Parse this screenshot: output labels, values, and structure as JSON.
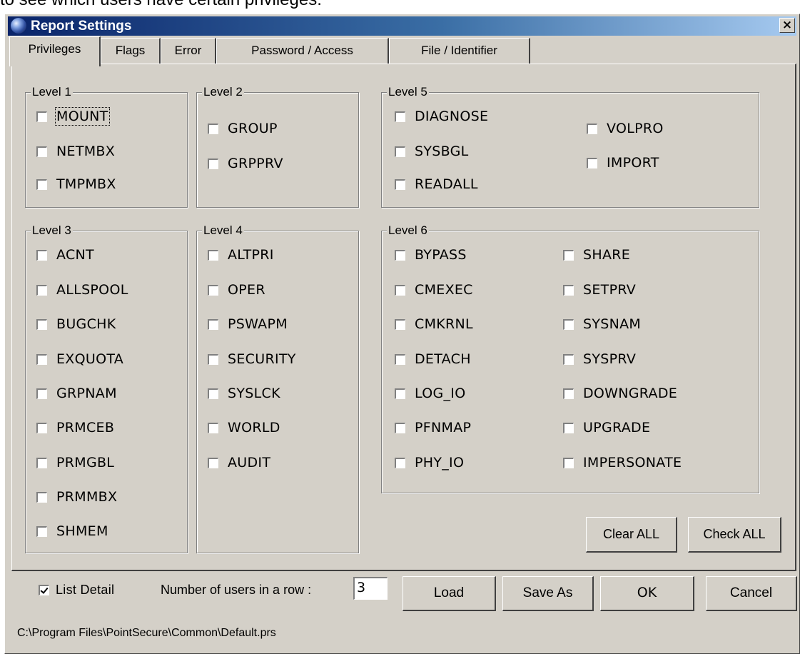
{
  "caption": "to see which users have certain privileges.",
  "window": {
    "title": "Report Settings",
    "close_label": "×"
  },
  "tabs": [
    "Privileges",
    "Flags",
    "Error",
    "Password / Access",
    "File / Identifier"
  ],
  "groups": {
    "level1": {
      "label": "Level 1",
      "items": [
        "MOUNT",
        "NETMBX",
        "TMPMBX"
      ]
    },
    "level2": {
      "label": "Level 2",
      "items": [
        "GROUP",
        "GRPPRV"
      ]
    },
    "level5": {
      "label": "Level 5",
      "items": [
        "DIAGNOSE",
        "SYSBGL",
        "READALL",
        "VOLPRO",
        "IMPORT"
      ]
    },
    "level3": {
      "label": "Level 3",
      "items": [
        "ACNT",
        "ALLSPOOL",
        "BUGCHK",
        "EXQUOTA",
        "GRPNAM",
        "PRMCEB",
        "PRMGBL",
        "PRMMBX",
        "SHMEM"
      ]
    },
    "level4": {
      "label": "Level 4",
      "items": [
        "ALTPRI",
        "OPER",
        "PSWAPM",
        "SECURITY",
        "SYSLCK",
        "WORLD",
        "AUDIT"
      ]
    },
    "level6": {
      "label": "Level 6",
      "items": [
        "BYPASS",
        "CMEXEC",
        "CMKRNL",
        "DETACH",
        "LOG_IO",
        "PFNMAP",
        "PHY_IO",
        "SHARE",
        "SETPRV",
        "SYSNAM",
        "SYSPRV",
        "DOWNGRADE",
        "UPGRADE",
        "IMPERSONATE"
      ]
    }
  },
  "panel_buttons": {
    "clear_all": "Clear ALL",
    "check_all": "Check ALL"
  },
  "footer": {
    "list_detail_label": "List Detail",
    "list_detail_checked": true,
    "users_row_label": "Number of users in a row :",
    "users_row_value": "3",
    "load": "Load",
    "save_as": "Save As",
    "ok": "OK",
    "cancel": "Cancel",
    "path": "C:\\Program Files\\PointSecure\\Common\\Default.prs"
  }
}
